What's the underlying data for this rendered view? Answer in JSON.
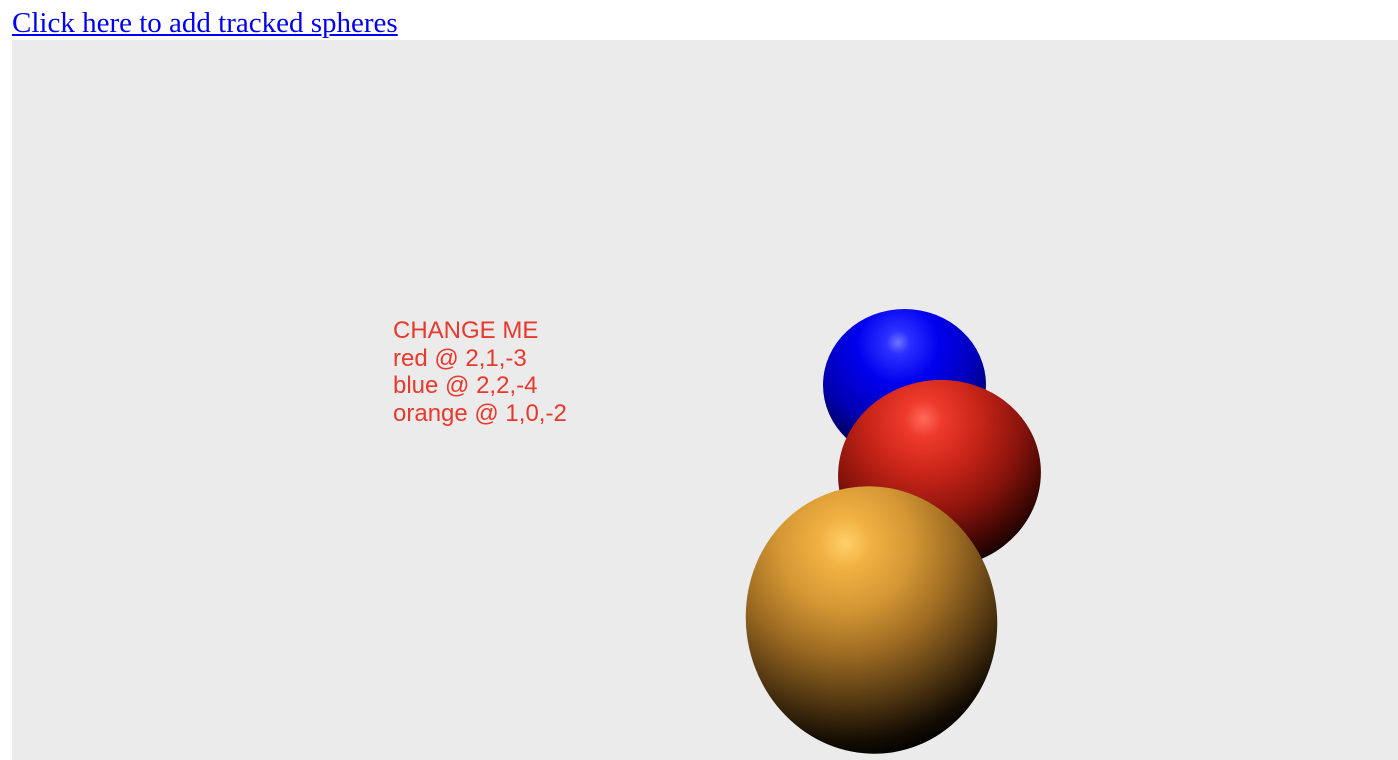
{
  "link": {
    "text": "Click here to add tracked spheres"
  },
  "scene": {
    "background_color": "#ebebeb",
    "label_color": "#e8392d",
    "label_lines": [
      "CHANGE ME",
      "red @ 2,1,-3",
      "blue @ 2,2,-4",
      "orange @ 1,0,-2"
    ],
    "spheres": [
      {
        "name": "blue",
        "color": "#0000ee"
      },
      {
        "name": "red",
        "color": "#e8392d"
      },
      {
        "name": "orange",
        "color": "#f2b142"
      }
    ]
  }
}
